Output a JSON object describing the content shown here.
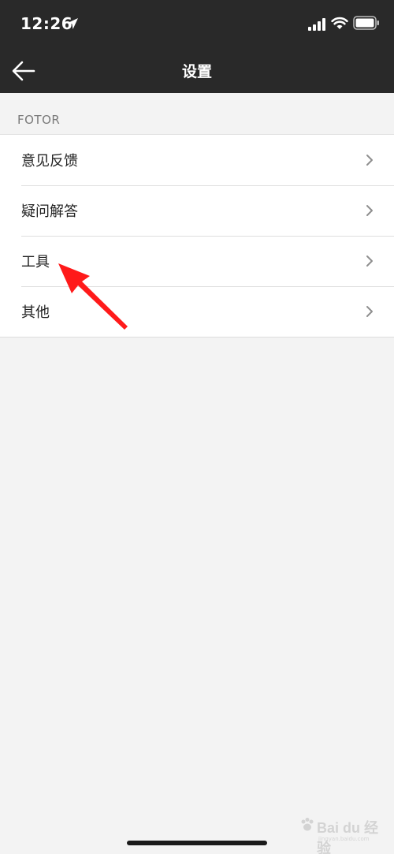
{
  "status_bar": {
    "time": "12:26"
  },
  "nav": {
    "title": "设置"
  },
  "section": {
    "header": "FOTOR"
  },
  "list": {
    "items": [
      {
        "label": "意见反馈"
      },
      {
        "label": "疑问解答"
      },
      {
        "label": "工具"
      },
      {
        "label": "其他"
      }
    ]
  },
  "watermark": {
    "text": "Bai du 经验",
    "sub": "jingyan.baidu.com"
  },
  "colors": {
    "topbar": "#292929",
    "background": "#f3f3f3",
    "arrow": "#ff1a1a"
  },
  "icons": {
    "back": "back-arrow-icon",
    "chevron": "chevron-right-icon",
    "location": "location-arrow-icon",
    "signal": "cellular-signal-icon",
    "wifi": "wifi-icon",
    "battery": "battery-icon"
  }
}
